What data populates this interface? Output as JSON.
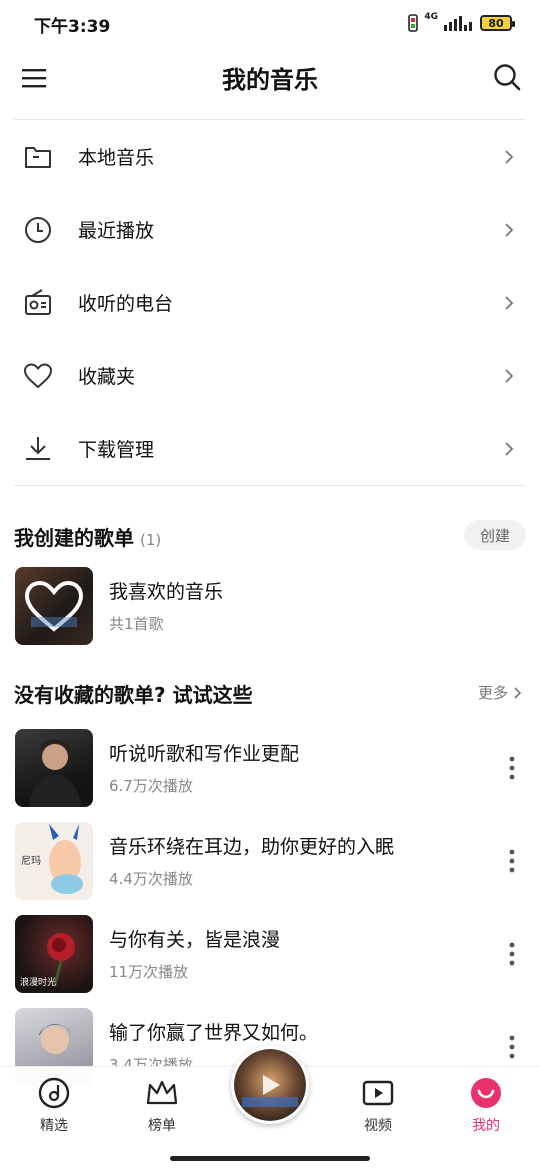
{
  "status": {
    "time": "下午3:39",
    "network": "4G",
    "battery": "80"
  },
  "header": {
    "title": "我的音乐"
  },
  "menu": [
    {
      "label": "本地音乐",
      "icon": "folder-icon"
    },
    {
      "label": "最近播放",
      "icon": "clock-icon"
    },
    {
      "label": "收听的电台",
      "icon": "radio-icon"
    },
    {
      "label": "收藏夹",
      "icon": "heart-icon"
    },
    {
      "label": "下载管理",
      "icon": "download-icon"
    }
  ],
  "created": {
    "title": "我创建的歌单",
    "count": "(1)",
    "create_label": "创建",
    "items": [
      {
        "name": "我喜欢的音乐",
        "sub": "共1首歌"
      }
    ]
  },
  "suggest": {
    "title": "没有收藏的歌单? 试试这些",
    "more_label": "更多",
    "items": [
      {
        "name": "听说听歌和写作业更配",
        "sub": "6.7万次播放"
      },
      {
        "name": "音乐环绕在耳边，助你更好的入眠",
        "sub": "4.4万次播放",
        "cover_text": "尼玛"
      },
      {
        "name": "与你有关，皆是浪漫",
        "sub": "11万次播放",
        "cover_text": "浪漫时光"
      },
      {
        "name": "输了你赢了世界又如何。",
        "sub": "3.4万次播放"
      }
    ]
  },
  "tabs": [
    {
      "label": "精选",
      "icon": "disc-icon",
      "active": false
    },
    {
      "label": "榜单",
      "icon": "crown-icon",
      "active": false
    },
    {
      "label": "视频",
      "icon": "video-icon",
      "active": false
    },
    {
      "label": "我的",
      "icon": "smile-icon",
      "active": true
    }
  ],
  "colors": {
    "accent": "#e8336d"
  }
}
